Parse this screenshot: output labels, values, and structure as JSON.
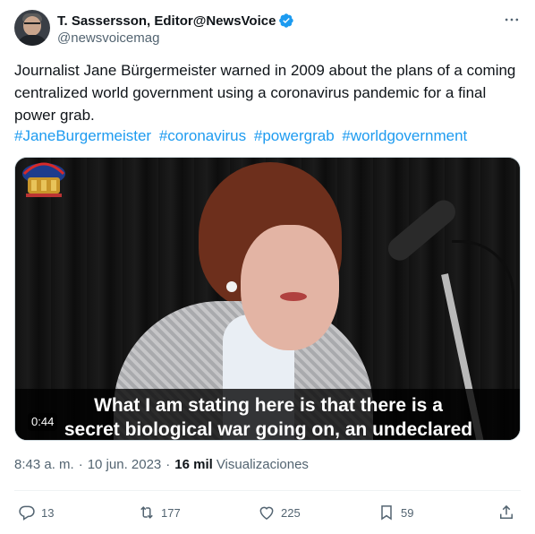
{
  "author": {
    "display_name": "T. Sassersson, Editor@NewsVoice",
    "handle": "@newsvoicemag",
    "verified_icon": "verified-badge-icon",
    "more_icon": "more-horizontal-icon"
  },
  "tweet": {
    "text": "Journalist Jane Bürgermeister warned in 2009 about the plans of a coming centralized world government using a coronavirus pandemic for a final power grab.",
    "hashtags": [
      "#JaneBurgermeister",
      "#coronavirus",
      "#powergrab",
      "#worldgovernment"
    ]
  },
  "media": {
    "duration": "0:44",
    "subtitle_line1": "What I am stating here is that there is a",
    "subtitle_line2": "secret biological war going on, an undeclared"
  },
  "meta": {
    "time": "8:43 a. m.",
    "separator": "·",
    "date": "10 jun. 2023",
    "views_count": "16 mil",
    "views_label": "Visualizaciones"
  },
  "actions": {
    "replies": "13",
    "retweets": "177",
    "likes": "225",
    "bookmarks": "59"
  },
  "colors": {
    "accent": "#1d9bf0",
    "muted": "#536471",
    "text": "#0f1419"
  }
}
